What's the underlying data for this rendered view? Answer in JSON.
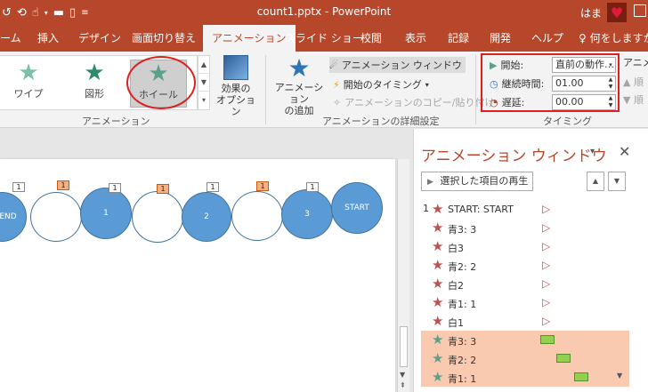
{
  "window": {
    "doc_title": "count1.pptx  -  PowerPoint",
    "user": "はま"
  },
  "tabs": [
    {
      "label": "ーム"
    },
    {
      "label": "挿入"
    },
    {
      "label": "デザイン"
    },
    {
      "label": "画面切り替え"
    },
    {
      "label": "アニメーション",
      "active": true
    },
    {
      "label": "スライド ショー"
    },
    {
      "label": "校閲"
    },
    {
      "label": "表示"
    },
    {
      "label": "記録"
    },
    {
      "label": "開発"
    },
    {
      "label": "ヘルプ"
    }
  ],
  "tell_me": "何をしますか",
  "ribbon": {
    "gallery_items": [
      {
        "label": "ワイプ",
        "icon": "star-icon"
      },
      {
        "label": "図形",
        "icon": "star-icon"
      },
      {
        "label": "ホイール",
        "icon": "star-icon",
        "selected": true
      }
    ],
    "effect_options": "効果の\nオプション",
    "animation_group_label": "アニメーション",
    "add_animation": "アニメーション\nの追加",
    "animation_pane_btn": "アニメーション ウィンドウ",
    "trigger_btn": "開始のタイミング",
    "painter_btn": "アニメーションのコピー/貼り付け",
    "advanced_group_label": "アニメーションの詳細設定",
    "timing_group_label": "タイミング",
    "right_group_label": "アニメー",
    "timing": {
      "start_label": "開始:",
      "start_value": "直前の動作…",
      "duration_label": "継続時間:",
      "duration_value": "01.00",
      "delay_label": "遅延:",
      "delay_value": "00.00"
    }
  },
  "slide": {
    "circles": [
      {
        "text": "END",
        "style": "blue"
      },
      {
        "text": "",
        "style": "white"
      },
      {
        "text": "1",
        "style": "blue"
      },
      {
        "text": "",
        "style": "white"
      },
      {
        "text": "2",
        "style": "blue"
      },
      {
        "text": "",
        "style": "white"
      },
      {
        "text": "3",
        "style": "blue"
      },
      {
        "text": "START",
        "style": "blue"
      }
    ],
    "tags": [
      {
        "text": "1",
        "style": "white"
      },
      {
        "text": "1",
        "style": "orange"
      },
      {
        "text": "1",
        "style": "white"
      },
      {
        "text": "1",
        "style": "orange"
      },
      {
        "text": "1",
        "style": "white"
      },
      {
        "text": "1",
        "style": "orange"
      },
      {
        "text": "1",
        "style": "white"
      }
    ]
  },
  "pane": {
    "title": "アニメーション ウィンドウ",
    "play_button": "選択した項目の再生",
    "items": [
      {
        "index": "1",
        "label": "START: START",
        "kind": "trigger"
      },
      {
        "index": "",
        "label": "青3: 3",
        "kind": "trigger"
      },
      {
        "index": "",
        "label": "白3",
        "kind": "trigger"
      },
      {
        "index": "",
        "label": "青2: 2",
        "kind": "trigger"
      },
      {
        "index": "",
        "label": "白2",
        "kind": "trigger"
      },
      {
        "index": "",
        "label": "青1: 1",
        "kind": "trigger"
      },
      {
        "index": "",
        "label": "白1",
        "kind": "trigger"
      },
      {
        "index": "",
        "label": "青3: 3",
        "kind": "bar",
        "selected": true
      },
      {
        "index": "",
        "label": "青2: 2",
        "kind": "bar",
        "selected": true
      },
      {
        "index": "",
        "label": "青1: 1",
        "kind": "bar",
        "selected": true
      }
    ]
  },
  "colors": {
    "accent": "#b7472a",
    "star_red": "#c0504d",
    "star_green": "#5aa08a",
    "circle_blue": "#5b9bd5",
    "bar_green": "#92d050",
    "selection": "#f9c9b0"
  }
}
